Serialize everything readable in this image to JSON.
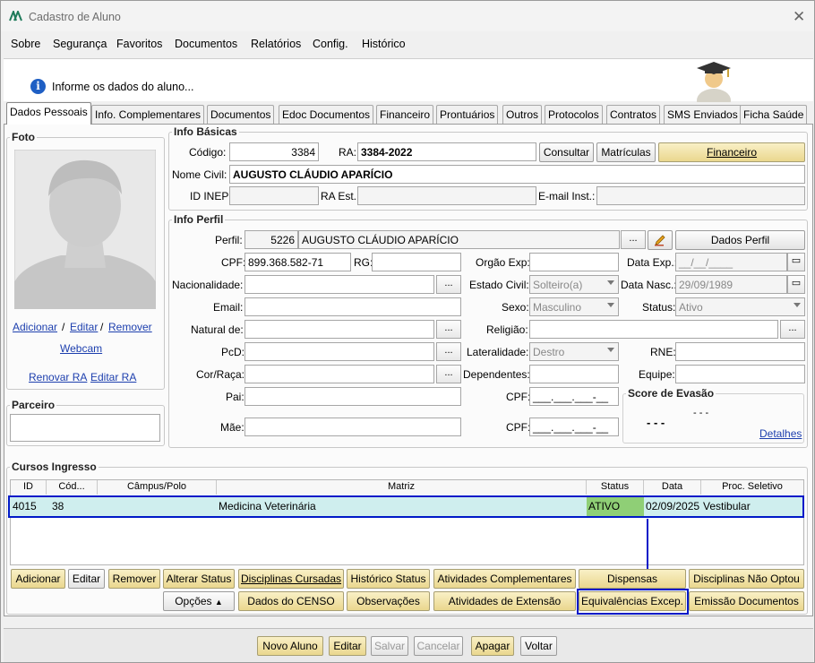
{
  "window": {
    "title": "Cadastro de Aluno"
  },
  "menu": [
    "Sobre",
    "Segurança",
    "Favoritos",
    "Documentos",
    "Relatórios",
    "Config.",
    "Histórico"
  ],
  "header": {
    "info": "Informe os dados do aluno..."
  },
  "tabs": [
    "Dados Pessoais",
    "Info. Complementares",
    "Documentos",
    "Edoc Documentos",
    "Financeiro",
    "Prontuários",
    "Outros",
    "Protocolos",
    "Contratos",
    "SMS Enviados",
    "Ficha Saúde"
  ],
  "foto": {
    "title": "Foto",
    "adicionar": "Adicionar",
    "editar": "Editar",
    "remover": "Remover",
    "sep": "/",
    "webcam": "Webcam",
    "renovar_ra": "Renovar RA",
    "editar_ra": "Editar RA"
  },
  "parceiro": {
    "title": "Parceiro"
  },
  "info_basicas": {
    "title": "Info Básicas",
    "codigo_label": "Código:",
    "codigo": "3384",
    "ra_label": "RA:",
    "ra": "3384-2022",
    "consultar": "Consultar",
    "matriculas": "Matrículas",
    "financeiro": "Financeiro",
    "nome_civil_label": "Nome Civil:",
    "nome_civil": "AUGUSTO CLÁUDIO APARÍCIO",
    "id_inep_label": "ID INEP:",
    "ra_est_label": "RA Est.:",
    "email_inst_label": "E-mail Inst.:"
  },
  "info_perfil": {
    "title": "Info Perfil",
    "perfil_label": "Perfil:",
    "perfil_id": "5226",
    "perfil_nome": "AUGUSTO CLÁUDIO APARÍCIO",
    "dots": "...",
    "dados_perfil": "Dados Perfil",
    "cpf_label": "CPF:",
    "cpf": "899.368.582-71",
    "rg_label": "RG:",
    "orgao_exp_label": "Orgão Exp:",
    "data_exp_label": "Data Exp.:",
    "data_exp": "__/__/____",
    "nacionalidade_label": "Nacionalidade:",
    "estado_civil_label": "Estado Civil:",
    "estado_civil": "Solteiro(a)",
    "data_nasc_label": "Data Nasc.:",
    "data_nasc": "29/09/1989",
    "email_label": "Email:",
    "sexo_label": "Sexo:",
    "sexo": "Masculino",
    "status_label": "Status:",
    "status": "Ativo",
    "natural_label": "Natural de:",
    "religiao_label": "Religião:",
    "pcd_label": "PcD:",
    "lateralidade_label": "Lateralidade:",
    "lateralidade": "Destro",
    "rne_label": "RNE:",
    "cor_label": "Cor/Raça:",
    "dependentes_label": "Dependentes:",
    "equipe_label": "Equipe:",
    "pai_label": "Pai:",
    "cpf_pai_label": "CPF:",
    "cpf_pai": "___.___.___-__",
    "mae_label": "Mãe:",
    "cpf_mae_label": "CPF:",
    "cpf_mae": "___.___.___-__",
    "score_title": "Score de Evasão",
    "score_value1": "- - -",
    "score_value2": "- - -",
    "detalhes": "Detalhes"
  },
  "cursos": {
    "title": "Cursos Ingresso",
    "columns": [
      "ID",
      "Cód...",
      "Câmpus/Polo",
      "Matriz",
      "Status",
      "Data",
      "Proc. Seletivo"
    ],
    "rows": [
      {
        "id": "4015",
        "cod": "38",
        "campus": "",
        "matriz": "Medicina Veterinária",
        "status": "ATIVO",
        "data": "02/09/2025",
        "proc": "Vestibular"
      }
    ]
  },
  "buttons_row1": [
    "Adicionar",
    "Editar",
    "Remover",
    "Alterar Status",
    "Disciplinas Cursadas",
    "Histórico Status",
    "Atividades Complementares",
    "Dispensas",
    "Disciplinas Não Optou"
  ],
  "buttons_row2": [
    "Opções",
    "Dados do CENSO",
    "Observações",
    "Atividades de Extensão",
    "Equivalências Excep.",
    "Emissão Documentos"
  ],
  "footer": [
    "Novo Aluno",
    "Editar",
    "Salvar",
    "Cancelar",
    "Apagar",
    "Voltar"
  ],
  "colors": {
    "selection_border": "#0019c8",
    "status_green": "#8fcf76",
    "row_teal": "#cfeeee",
    "gold": "#ead78e"
  }
}
